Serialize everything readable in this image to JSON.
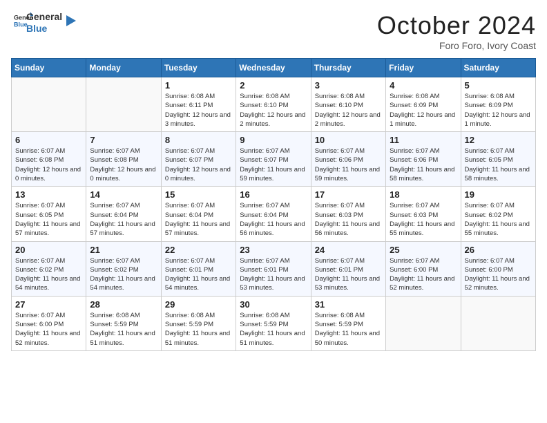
{
  "logo": {
    "general": "General",
    "blue": "Blue"
  },
  "title": "October 2024",
  "subtitle": "Foro Foro, Ivory Coast",
  "headers": [
    "Sunday",
    "Monday",
    "Tuesday",
    "Wednesday",
    "Thursday",
    "Friday",
    "Saturday"
  ],
  "weeks": [
    [
      {
        "day": "",
        "info": ""
      },
      {
        "day": "",
        "info": ""
      },
      {
        "day": "1",
        "info": "Sunrise: 6:08 AM\nSunset: 6:11 PM\nDaylight: 12 hours and 3 minutes."
      },
      {
        "day": "2",
        "info": "Sunrise: 6:08 AM\nSunset: 6:10 PM\nDaylight: 12 hours and 2 minutes."
      },
      {
        "day": "3",
        "info": "Sunrise: 6:08 AM\nSunset: 6:10 PM\nDaylight: 12 hours and 2 minutes."
      },
      {
        "day": "4",
        "info": "Sunrise: 6:08 AM\nSunset: 6:09 PM\nDaylight: 12 hours and 1 minute."
      },
      {
        "day": "5",
        "info": "Sunrise: 6:08 AM\nSunset: 6:09 PM\nDaylight: 12 hours and 1 minute."
      }
    ],
    [
      {
        "day": "6",
        "info": "Sunrise: 6:07 AM\nSunset: 6:08 PM\nDaylight: 12 hours and 0 minutes."
      },
      {
        "day": "7",
        "info": "Sunrise: 6:07 AM\nSunset: 6:08 PM\nDaylight: 12 hours and 0 minutes."
      },
      {
        "day": "8",
        "info": "Sunrise: 6:07 AM\nSunset: 6:07 PM\nDaylight: 12 hours and 0 minutes."
      },
      {
        "day": "9",
        "info": "Sunrise: 6:07 AM\nSunset: 6:07 PM\nDaylight: 11 hours and 59 minutes."
      },
      {
        "day": "10",
        "info": "Sunrise: 6:07 AM\nSunset: 6:06 PM\nDaylight: 11 hours and 59 minutes."
      },
      {
        "day": "11",
        "info": "Sunrise: 6:07 AM\nSunset: 6:06 PM\nDaylight: 11 hours and 58 minutes."
      },
      {
        "day": "12",
        "info": "Sunrise: 6:07 AM\nSunset: 6:05 PM\nDaylight: 11 hours and 58 minutes."
      }
    ],
    [
      {
        "day": "13",
        "info": "Sunrise: 6:07 AM\nSunset: 6:05 PM\nDaylight: 11 hours and 57 minutes."
      },
      {
        "day": "14",
        "info": "Sunrise: 6:07 AM\nSunset: 6:04 PM\nDaylight: 11 hours and 57 minutes."
      },
      {
        "day": "15",
        "info": "Sunrise: 6:07 AM\nSunset: 6:04 PM\nDaylight: 11 hours and 57 minutes."
      },
      {
        "day": "16",
        "info": "Sunrise: 6:07 AM\nSunset: 6:04 PM\nDaylight: 11 hours and 56 minutes."
      },
      {
        "day": "17",
        "info": "Sunrise: 6:07 AM\nSunset: 6:03 PM\nDaylight: 11 hours and 56 minutes."
      },
      {
        "day": "18",
        "info": "Sunrise: 6:07 AM\nSunset: 6:03 PM\nDaylight: 11 hours and 55 minutes."
      },
      {
        "day": "19",
        "info": "Sunrise: 6:07 AM\nSunset: 6:02 PM\nDaylight: 11 hours and 55 minutes."
      }
    ],
    [
      {
        "day": "20",
        "info": "Sunrise: 6:07 AM\nSunset: 6:02 PM\nDaylight: 11 hours and 54 minutes."
      },
      {
        "day": "21",
        "info": "Sunrise: 6:07 AM\nSunset: 6:02 PM\nDaylight: 11 hours and 54 minutes."
      },
      {
        "day": "22",
        "info": "Sunrise: 6:07 AM\nSunset: 6:01 PM\nDaylight: 11 hours and 54 minutes."
      },
      {
        "day": "23",
        "info": "Sunrise: 6:07 AM\nSunset: 6:01 PM\nDaylight: 11 hours and 53 minutes."
      },
      {
        "day": "24",
        "info": "Sunrise: 6:07 AM\nSunset: 6:01 PM\nDaylight: 11 hours and 53 minutes."
      },
      {
        "day": "25",
        "info": "Sunrise: 6:07 AM\nSunset: 6:00 PM\nDaylight: 11 hours and 52 minutes."
      },
      {
        "day": "26",
        "info": "Sunrise: 6:07 AM\nSunset: 6:00 PM\nDaylight: 11 hours and 52 minutes."
      }
    ],
    [
      {
        "day": "27",
        "info": "Sunrise: 6:07 AM\nSunset: 6:00 PM\nDaylight: 11 hours and 52 minutes."
      },
      {
        "day": "28",
        "info": "Sunrise: 6:08 AM\nSunset: 5:59 PM\nDaylight: 11 hours and 51 minutes."
      },
      {
        "day": "29",
        "info": "Sunrise: 6:08 AM\nSunset: 5:59 PM\nDaylight: 11 hours and 51 minutes."
      },
      {
        "day": "30",
        "info": "Sunrise: 6:08 AM\nSunset: 5:59 PM\nDaylight: 11 hours and 51 minutes."
      },
      {
        "day": "31",
        "info": "Sunrise: 6:08 AM\nSunset: 5:59 PM\nDaylight: 11 hours and 50 minutes."
      },
      {
        "day": "",
        "info": ""
      },
      {
        "day": "",
        "info": ""
      }
    ]
  ]
}
